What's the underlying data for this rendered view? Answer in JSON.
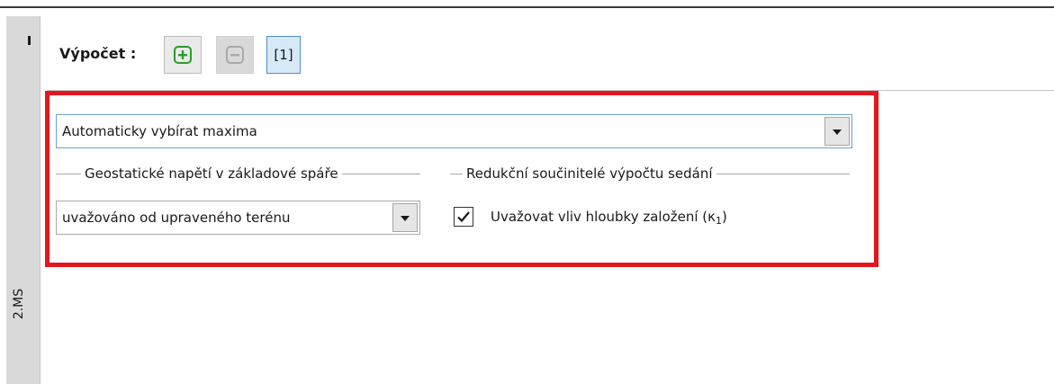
{
  "side_strip": {
    "label": "2.MS"
  },
  "toolbar": {
    "label": "Výpočet :",
    "add_button_icon": "plus-square-icon",
    "remove_button_icon": "minus-square-icon",
    "active_index": "[1]"
  },
  "settings": {
    "mode_select": {
      "value": "Automaticky vybírat maxima"
    },
    "geostatic_group": {
      "title": "Geostatické napětí v základové spáře",
      "select_value": "uvažováno od upraveného terénu"
    },
    "reduction_group": {
      "title": "Redukční součinitelé výpočtu sedání",
      "checkbox": {
        "label": "Uvažovat vliv hloubky založení (κ",
        "label_subscript": "1",
        "label_suffix": ")",
        "checked": true
      }
    }
  },
  "colors": {
    "highlight": "#e5151f",
    "add_icon": "#2e9a2e",
    "remove_icon": "#a8a8a8",
    "active_border": "#4d8fd3",
    "active_fill": "#d7e8f7"
  }
}
